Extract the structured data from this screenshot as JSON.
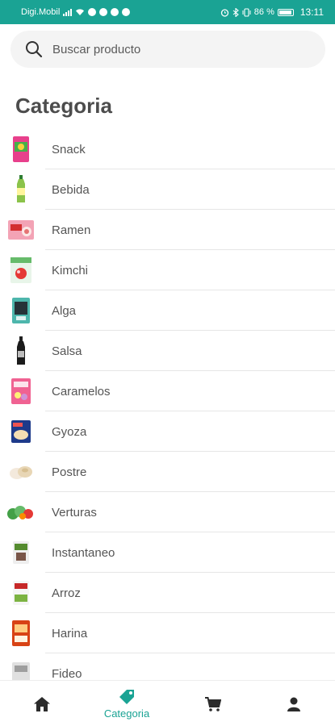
{
  "status_bar": {
    "carrier": "Digi.Mobil",
    "battery": "86 %",
    "time": "13:11"
  },
  "search": {
    "placeholder": "Buscar producto",
    "icon": "search-icon"
  },
  "page_title": "Categoria",
  "categories": [
    {
      "label": "Snack",
      "icon": "snack-package-thumbnail"
    },
    {
      "label": "Bebida",
      "icon": "drink-bottle-thumbnail"
    },
    {
      "label": "Ramen",
      "icon": "ramen-package-thumbnail"
    },
    {
      "label": "Kimchi",
      "icon": "kimchi-package-thumbnail"
    },
    {
      "label": "Alga",
      "icon": "seaweed-package-thumbnail"
    },
    {
      "label": "Salsa",
      "icon": "sauce-bottle-thumbnail"
    },
    {
      "label": "Caramelos",
      "icon": "candy-package-thumbnail"
    },
    {
      "label": "Gyoza",
      "icon": "gyoza-package-thumbnail"
    },
    {
      "label": "Postre",
      "icon": "dessert-thumbnail"
    },
    {
      "label": "Verturas",
      "icon": "vegetables-thumbnail"
    },
    {
      "label": "Instantaneo",
      "icon": "instant-food-thumbnail"
    },
    {
      "label": "Arroz",
      "icon": "rice-package-thumbnail"
    },
    {
      "label": "Harina",
      "icon": "flour-package-thumbnail"
    },
    {
      "label": "Fideo",
      "icon": "noodle-package-thumbnail"
    }
  ],
  "bottom_nav": {
    "items": [
      {
        "icon": "home-icon",
        "label": ""
      },
      {
        "icon": "tag-icon",
        "label": "Categoria"
      },
      {
        "icon": "cart-icon",
        "label": ""
      },
      {
        "icon": "profile-icon",
        "label": ""
      }
    ],
    "active_color": "#1aa394",
    "inactive_color": "#2b2b2b"
  },
  "colors": {
    "accent": "#1aa394",
    "title": "#4c4c4c",
    "text": "#555555"
  }
}
